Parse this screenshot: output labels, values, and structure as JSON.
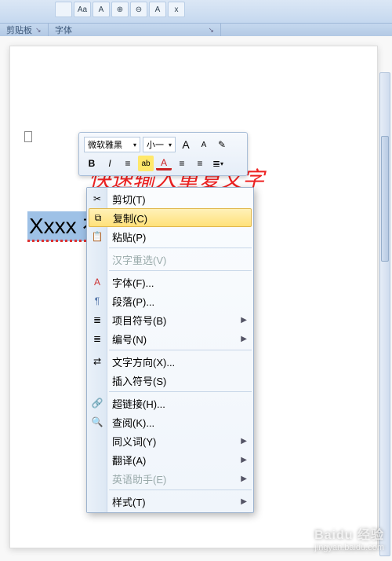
{
  "ribbon": {
    "btns": [
      "",
      "Aa",
      "A",
      "⊕",
      "⊖",
      "A",
      "x"
    ],
    "group_clipboard": "剪贴板",
    "group_font": "字体"
  },
  "document": {
    "red_heading": "快速输入重复文字",
    "selected_text": "Xxxx 社团"
  },
  "mini_toolbar": {
    "font_name": "微软雅黑",
    "font_size": "小一",
    "grow_font": "A",
    "shrink_font": "A",
    "style_brush": "✎",
    "bold": "B",
    "italic": "I",
    "align": "≡",
    "highlight": "ab",
    "font_color": "A",
    "indent_dec": "≡",
    "indent_inc": "≡",
    "bullets": "≣"
  },
  "context_menu": [
    {
      "icon": "✂",
      "label": "剪切(T)"
    },
    {
      "icon": "⧉",
      "label": "复制(C)",
      "hover": true
    },
    {
      "icon": "📋",
      "label": "粘贴(P)"
    },
    {
      "sep": true
    },
    {
      "label": "汉字重选(V)",
      "disabled": true
    },
    {
      "sep": true
    },
    {
      "icon": "A",
      "label": "字体(F)...",
      "icon_color": "#c33"
    },
    {
      "icon": "¶",
      "label": "段落(P)...",
      "icon_color": "#57a"
    },
    {
      "icon": "≣",
      "label": "项目符号(B)",
      "sub": true
    },
    {
      "icon": "≣",
      "label": "编号(N)",
      "sub": true
    },
    {
      "sep": true
    },
    {
      "icon": "⇄",
      "label": "文字方向(X)..."
    },
    {
      "label": "插入符号(S)"
    },
    {
      "sep": true
    },
    {
      "icon": "🔗",
      "label": "超链接(H)..."
    },
    {
      "icon": "🔍",
      "label": "查阅(K)..."
    },
    {
      "label": "同义词(Y)",
      "sub": true
    },
    {
      "label": "翻译(A)",
      "sub": true
    },
    {
      "label": "英语助手(E)",
      "disabled": true,
      "sub": true
    },
    {
      "sep": true
    },
    {
      "label": "样式(T)",
      "sub": true
    }
  ],
  "watermark": {
    "logo": "Baidu 经验",
    "url": "jingyan.baidu.com"
  }
}
